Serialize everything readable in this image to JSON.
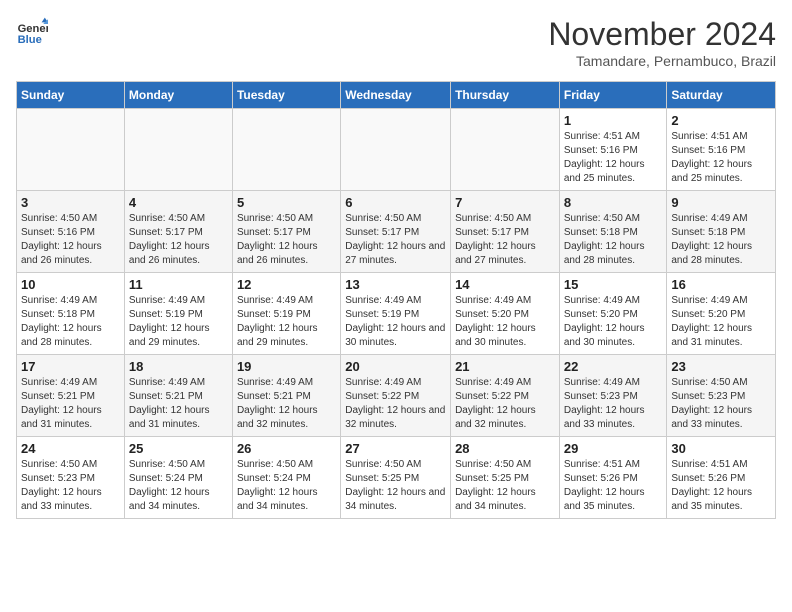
{
  "logo": {
    "line1": "General",
    "line2": "Blue"
  },
  "title": "November 2024",
  "location": "Tamandare, Pernambuco, Brazil",
  "weekdays": [
    "Sunday",
    "Monday",
    "Tuesday",
    "Wednesday",
    "Thursday",
    "Friday",
    "Saturday"
  ],
  "weeks": [
    [
      {
        "day": "",
        "info": ""
      },
      {
        "day": "",
        "info": ""
      },
      {
        "day": "",
        "info": ""
      },
      {
        "day": "",
        "info": ""
      },
      {
        "day": "",
        "info": ""
      },
      {
        "day": "1",
        "info": "Sunrise: 4:51 AM\nSunset: 5:16 PM\nDaylight: 12 hours and 25 minutes."
      },
      {
        "day": "2",
        "info": "Sunrise: 4:51 AM\nSunset: 5:16 PM\nDaylight: 12 hours and 25 minutes."
      }
    ],
    [
      {
        "day": "3",
        "info": "Sunrise: 4:50 AM\nSunset: 5:16 PM\nDaylight: 12 hours and 26 minutes."
      },
      {
        "day": "4",
        "info": "Sunrise: 4:50 AM\nSunset: 5:17 PM\nDaylight: 12 hours and 26 minutes."
      },
      {
        "day": "5",
        "info": "Sunrise: 4:50 AM\nSunset: 5:17 PM\nDaylight: 12 hours and 26 minutes."
      },
      {
        "day": "6",
        "info": "Sunrise: 4:50 AM\nSunset: 5:17 PM\nDaylight: 12 hours and 27 minutes."
      },
      {
        "day": "7",
        "info": "Sunrise: 4:50 AM\nSunset: 5:17 PM\nDaylight: 12 hours and 27 minutes."
      },
      {
        "day": "8",
        "info": "Sunrise: 4:50 AM\nSunset: 5:18 PM\nDaylight: 12 hours and 28 minutes."
      },
      {
        "day": "9",
        "info": "Sunrise: 4:49 AM\nSunset: 5:18 PM\nDaylight: 12 hours and 28 minutes."
      }
    ],
    [
      {
        "day": "10",
        "info": "Sunrise: 4:49 AM\nSunset: 5:18 PM\nDaylight: 12 hours and 28 minutes."
      },
      {
        "day": "11",
        "info": "Sunrise: 4:49 AM\nSunset: 5:19 PM\nDaylight: 12 hours and 29 minutes."
      },
      {
        "day": "12",
        "info": "Sunrise: 4:49 AM\nSunset: 5:19 PM\nDaylight: 12 hours and 29 minutes."
      },
      {
        "day": "13",
        "info": "Sunrise: 4:49 AM\nSunset: 5:19 PM\nDaylight: 12 hours and 30 minutes."
      },
      {
        "day": "14",
        "info": "Sunrise: 4:49 AM\nSunset: 5:20 PM\nDaylight: 12 hours and 30 minutes."
      },
      {
        "day": "15",
        "info": "Sunrise: 4:49 AM\nSunset: 5:20 PM\nDaylight: 12 hours and 30 minutes."
      },
      {
        "day": "16",
        "info": "Sunrise: 4:49 AM\nSunset: 5:20 PM\nDaylight: 12 hours and 31 minutes."
      }
    ],
    [
      {
        "day": "17",
        "info": "Sunrise: 4:49 AM\nSunset: 5:21 PM\nDaylight: 12 hours and 31 minutes."
      },
      {
        "day": "18",
        "info": "Sunrise: 4:49 AM\nSunset: 5:21 PM\nDaylight: 12 hours and 31 minutes."
      },
      {
        "day": "19",
        "info": "Sunrise: 4:49 AM\nSunset: 5:21 PM\nDaylight: 12 hours and 32 minutes."
      },
      {
        "day": "20",
        "info": "Sunrise: 4:49 AM\nSunset: 5:22 PM\nDaylight: 12 hours and 32 minutes."
      },
      {
        "day": "21",
        "info": "Sunrise: 4:49 AM\nSunset: 5:22 PM\nDaylight: 12 hours and 32 minutes."
      },
      {
        "day": "22",
        "info": "Sunrise: 4:49 AM\nSunset: 5:23 PM\nDaylight: 12 hours and 33 minutes."
      },
      {
        "day": "23",
        "info": "Sunrise: 4:50 AM\nSunset: 5:23 PM\nDaylight: 12 hours and 33 minutes."
      }
    ],
    [
      {
        "day": "24",
        "info": "Sunrise: 4:50 AM\nSunset: 5:23 PM\nDaylight: 12 hours and 33 minutes."
      },
      {
        "day": "25",
        "info": "Sunrise: 4:50 AM\nSunset: 5:24 PM\nDaylight: 12 hours and 34 minutes."
      },
      {
        "day": "26",
        "info": "Sunrise: 4:50 AM\nSunset: 5:24 PM\nDaylight: 12 hours and 34 minutes."
      },
      {
        "day": "27",
        "info": "Sunrise: 4:50 AM\nSunset: 5:25 PM\nDaylight: 12 hours and 34 minutes."
      },
      {
        "day": "28",
        "info": "Sunrise: 4:50 AM\nSunset: 5:25 PM\nDaylight: 12 hours and 34 minutes."
      },
      {
        "day": "29",
        "info": "Sunrise: 4:51 AM\nSunset: 5:26 PM\nDaylight: 12 hours and 35 minutes."
      },
      {
        "day": "30",
        "info": "Sunrise: 4:51 AM\nSunset: 5:26 PM\nDaylight: 12 hours and 35 minutes."
      }
    ]
  ]
}
